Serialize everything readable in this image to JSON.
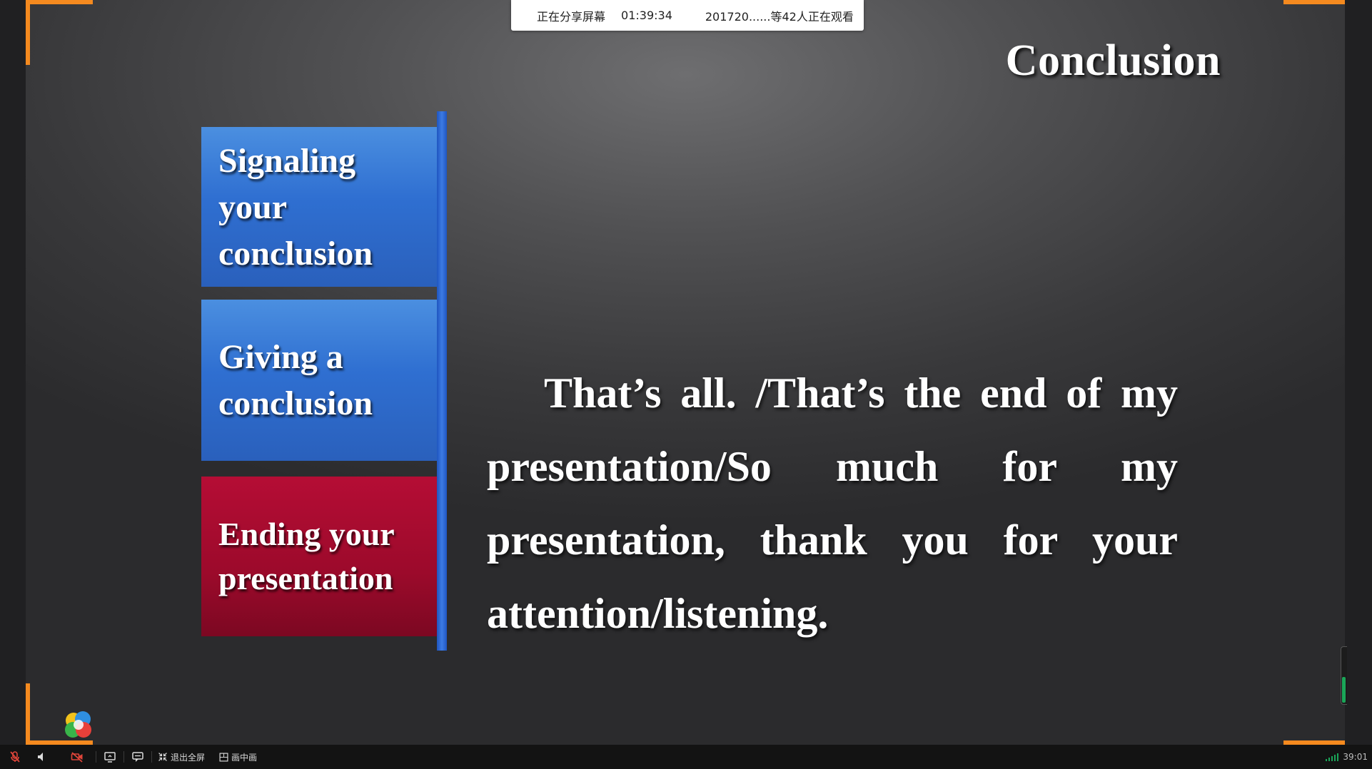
{
  "share_banner": {
    "status": "正在分享屏幕",
    "timer": "01:39:34",
    "viewers": "201720......等42人正在观看"
  },
  "slide": {
    "title": "Conclusion",
    "menu": [
      {
        "label": "Signaling your conclusion",
        "color": "#3576d6"
      },
      {
        "label": "Giving a conclusion",
        "color": "#3576d6"
      },
      {
        "label": "Ending your presentation",
        "color": "#a00b2e"
      }
    ],
    "body": "That’s all. /That’s the end of my presentation/So much for my presentation, thank you for your attention/listening."
  },
  "toolbar": {
    "icons": [
      "mic-muted-icon",
      "speaker-icon",
      "camera-off-icon",
      "screen-share-icon",
      "chat-icon"
    ],
    "exit_fullscreen_label": "退出全屏",
    "picture_in_picture_label": "画中画",
    "time": "39:01"
  },
  "colors": {
    "accent_orange": "#f58a1f",
    "muted_red": "#e0453a",
    "signal_green": "#1aa558"
  }
}
